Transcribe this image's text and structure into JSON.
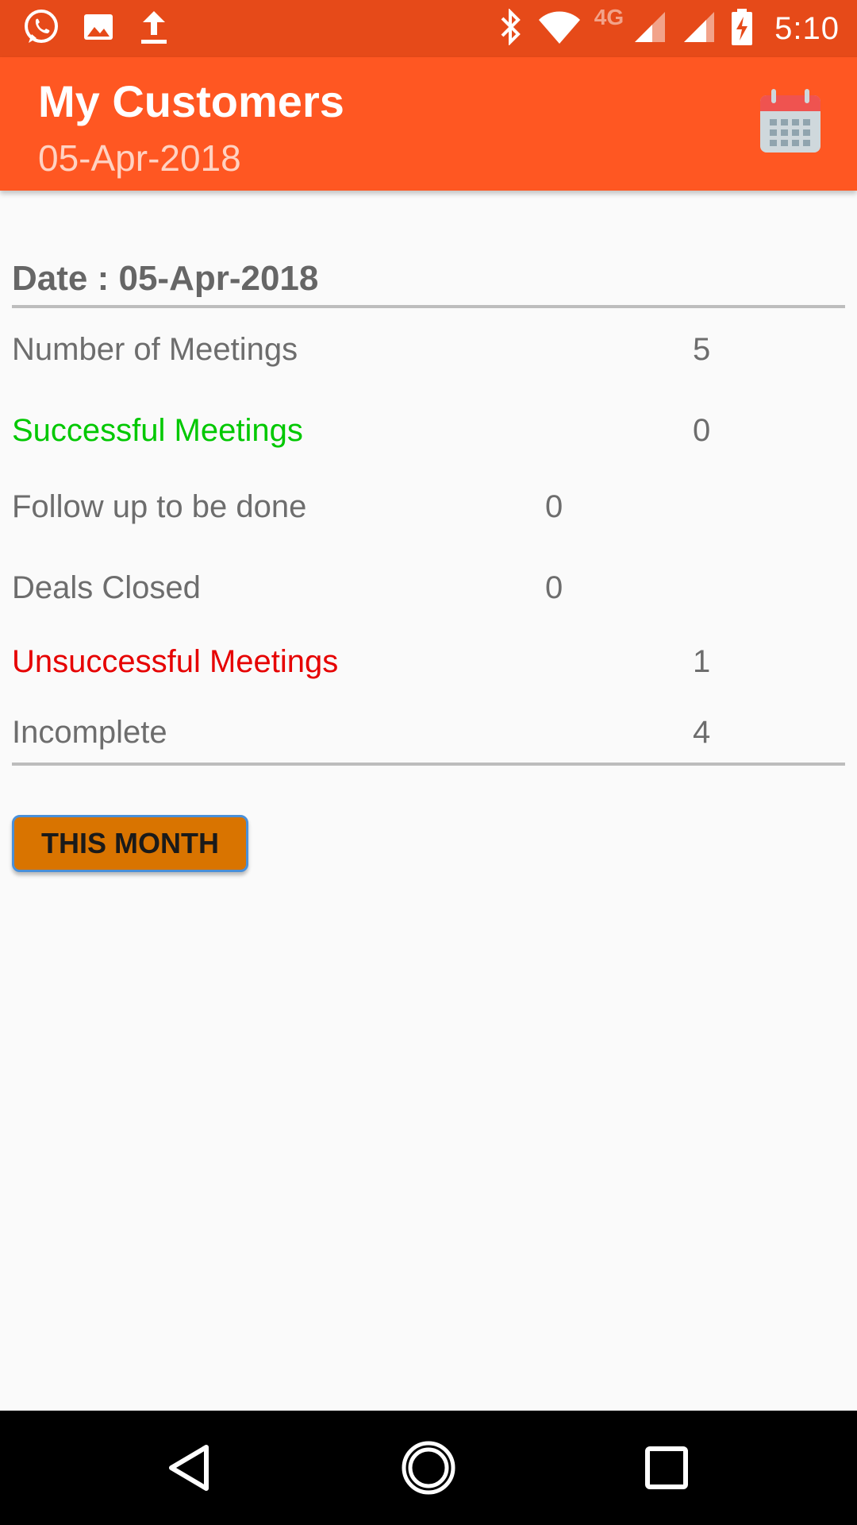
{
  "status_bar": {
    "time": "5:10",
    "network_label": "4G",
    "icons": [
      "whatsapp-icon",
      "image-icon",
      "upload-icon",
      "bluetooth-icon",
      "wifi-icon",
      "signal-icon",
      "signal-icon",
      "battery-charging-icon"
    ]
  },
  "app_bar": {
    "title": "My Customers",
    "subtitle": "05-Apr-2018",
    "action_icon": "calendar-icon",
    "background_color": "#ff5722"
  },
  "summary": {
    "date_heading": "Date : 05-Apr-2018",
    "rows": [
      {
        "label": "Number of Meetings",
        "value": "5"
      },
      {
        "label": "Successful Meetings",
        "value": "0",
        "color": "#00c800"
      },
      {
        "label": "Follow up to be done",
        "value": "0"
      },
      {
        "label": "Deals Closed",
        "value": "0"
      },
      {
        "label": "Unsuccessful Meetings",
        "value": "1",
        "color": "#e60000"
      },
      {
        "label": "Incomplete",
        "value": "4"
      }
    ]
  },
  "buttons": {
    "this_month": "THIS MONTH"
  },
  "nav_bar": {
    "icons": [
      "back-icon",
      "home-icon",
      "recents-icon"
    ]
  }
}
